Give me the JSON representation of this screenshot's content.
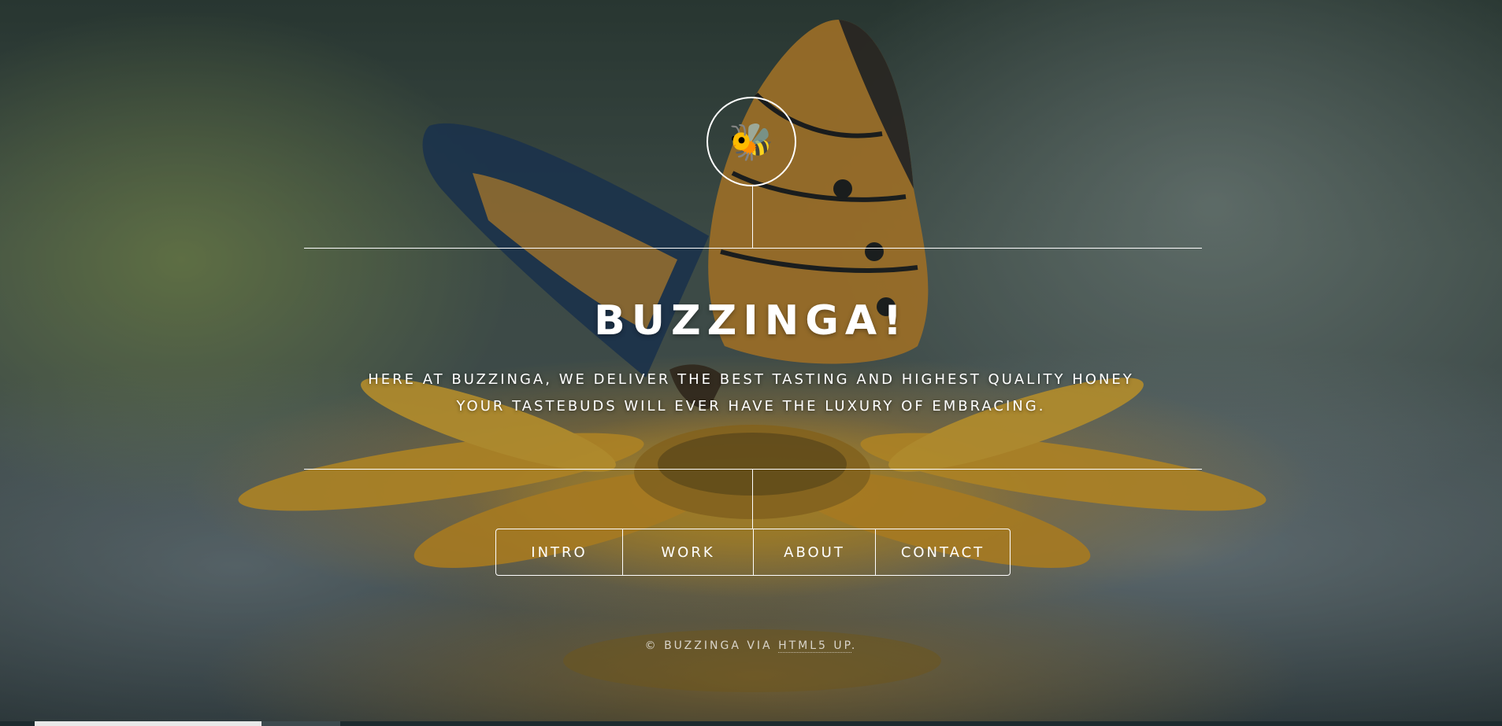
{
  "site": {
    "logo_icon": "bee-icon",
    "logo_glyph": "🐝",
    "title": "BUZZINGA!",
    "tagline_line1": "HERE AT BUZZINGA, WE DELIVER THE BEST TASTING AND HIGHEST QUALITY HONEY",
    "tagline_line2": "YOUR TASTEBUDS WILL EVER HAVE THE LUXURY OF EMBRACING."
  },
  "nav": {
    "items": [
      {
        "label": "INTRO"
      },
      {
        "label": "WORK"
      },
      {
        "label": "ABOUT"
      },
      {
        "label": "CONTACT"
      }
    ]
  },
  "footer": {
    "copyright": "© BUZZINGA VIA ",
    "credit_link": "HTML5 UP",
    "end": "."
  },
  "colors": {
    "text": "#ffffff",
    "flower": "#e8b230",
    "background": "#2f3f37"
  }
}
